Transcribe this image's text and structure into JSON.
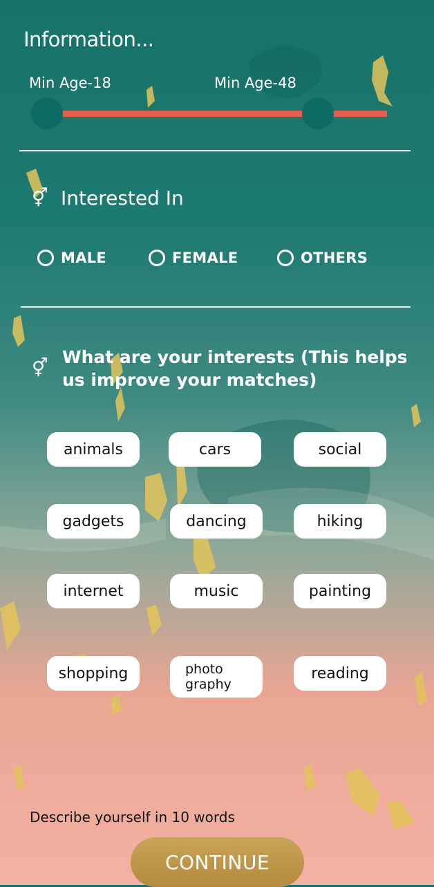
{
  "header": {
    "title": "Information..."
  },
  "age": {
    "min_label": "Min Age-18",
    "max_label": "Min Age-48",
    "min_value": 18,
    "max_value": 48,
    "accent": "#e3604f",
    "thumb_color": "#0d6a67"
  },
  "interested_in": {
    "heading": "Interested In",
    "icon": "gender-icon",
    "options": [
      {
        "label": "MALE"
      },
      {
        "label": "FEMALE"
      },
      {
        "label": "OTHERS"
      }
    ]
  },
  "interests": {
    "heading": "What are your interests (This helps us improve your matches)",
    "icon": "gender-icon",
    "chips": [
      {
        "label": "animals"
      },
      {
        "label": "cars"
      },
      {
        "label": "social"
      },
      {
        "label": "gadgets"
      },
      {
        "label": "dancing"
      },
      {
        "label": "hiking"
      },
      {
        "label": "internet"
      },
      {
        "label": "music"
      },
      {
        "label": "painting"
      },
      {
        "label": "shopping"
      },
      {
        "label": "photo\ngraphy"
      },
      {
        "label": "reading"
      }
    ]
  },
  "describe": {
    "label": "Describe yourself in 10 words"
  },
  "footer": {
    "continue_label": "CONTINUE",
    "button_color": "#c19a4d"
  }
}
